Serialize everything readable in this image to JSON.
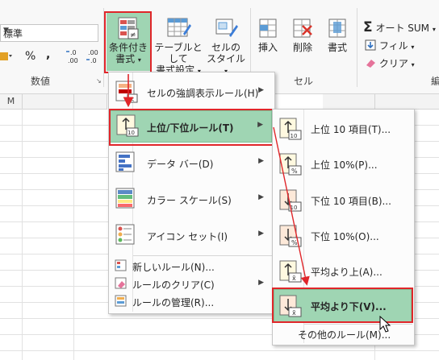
{
  "ribbon": {
    "number_format": "標準",
    "number_buttons": [
      "%",
      ",",
      ".00\n.0",
      ".00\n→.0"
    ],
    "number_group_label": "数値",
    "cond_format": {
      "line1": "条件付き",
      "line2": "書式"
    },
    "table_format": {
      "line1": "テーブルとして",
      "line2": "書式設定"
    },
    "cell_style": {
      "line1": "セルの",
      "line2": "スタイル"
    },
    "insert_label": "挿入",
    "delete_label": "削除",
    "format_label": "書式",
    "cell_group_label": "セル",
    "autosum_label": "オート SUM",
    "fill_label": "フィル",
    "clear_label": "クリア",
    "edit_group_label_partial": "編"
  },
  "sheet": {
    "first_col_header": "M"
  },
  "menu1": {
    "items": [
      {
        "label": "セルの強調表示ルール(H)",
        "icon": "highlight-rules-icon"
      },
      {
        "label": "上位/下位ルール(T)",
        "icon": "top-bottom-rules-icon"
      },
      {
        "label": "データ バー(D)",
        "icon": "data-bars-icon"
      },
      {
        "label": "カラー スケール(S)",
        "icon": "color-scales-icon"
      },
      {
        "label": "アイコン セット(I)",
        "icon": "icon-sets-icon"
      }
    ],
    "small_items": [
      {
        "label": "新しいルール(N)...",
        "icon": "new-rule-icon"
      },
      {
        "label": "ルールのクリア(C)",
        "icon": "clear-rules-icon"
      },
      {
        "label": "ルールの管理(R)...",
        "icon": "manage-rules-icon"
      }
    ]
  },
  "menu2": {
    "items": [
      {
        "label": "上位 10 項目(T)...",
        "icon_badge": "10"
      },
      {
        "label": "上位 10%(P)...",
        "icon_badge": "%"
      },
      {
        "label": "下位 10 項目(B)...",
        "icon_badge": "10"
      },
      {
        "label": "下位 10%(O)...",
        "icon_badge": "%"
      },
      {
        "label": "平均より上(A)...",
        "icon_badge": "x̄"
      },
      {
        "label": "平均より下(V)...",
        "icon_badge": "x̄"
      }
    ],
    "more_label": "その他のルール(M)..."
  },
  "colors": {
    "highlight": "#9fd5b3",
    "annotation_red": "#e0262a"
  }
}
